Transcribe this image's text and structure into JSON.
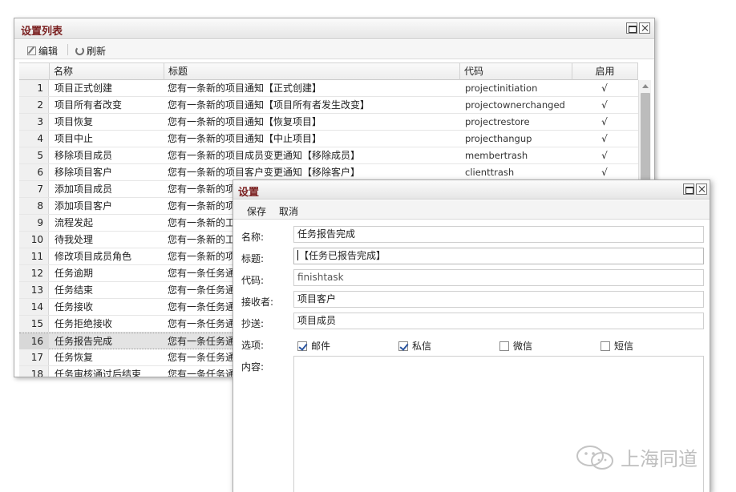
{
  "list_window": {
    "title": "设置列表",
    "toolbar": {
      "edit_label": "编辑",
      "refresh_label": "刷新"
    },
    "columns": {
      "name": "名称",
      "title": "标题",
      "code": "代码",
      "enabled": "启用"
    },
    "rows": [
      {
        "num": "1",
        "name": "项目正式创建",
        "title": "您有一条新的项目通知【正式创建】",
        "code": "projectinitiation",
        "enabled": "√"
      },
      {
        "num": "2",
        "name": "项目所有者改变",
        "title": "您有一条新的项目通知【项目所有者发生改变】",
        "code": "projectownerchanged",
        "enabled": "√"
      },
      {
        "num": "3",
        "name": "项目恢复",
        "title": "您有一条新的项目通知【恢复项目】",
        "code": "projectrestore",
        "enabled": "√"
      },
      {
        "num": "4",
        "name": "项目中止",
        "title": "您有一条新的项目通知【中止项目】",
        "code": "projecthangup",
        "enabled": "√"
      },
      {
        "num": "5",
        "name": "移除项目成员",
        "title": "您有一条新的项目成员变更通知【移除成员】",
        "code": "membertrash",
        "enabled": "√"
      },
      {
        "num": "6",
        "name": "移除项目客户",
        "title": "您有一条新的项目客户变更通知【移除客户】",
        "code": "clienttrash",
        "enabled": "√"
      },
      {
        "num": "7",
        "name": "添加项目成员",
        "title": "您有一条新的项",
        "code": "",
        "enabled": ""
      },
      {
        "num": "8",
        "name": "添加项目客户",
        "title": "您有一条新的项",
        "code": "",
        "enabled": ""
      },
      {
        "num": "9",
        "name": "流程发起",
        "title": "您有一条新的工",
        "code": "",
        "enabled": ""
      },
      {
        "num": "10",
        "name": "待我处理",
        "title": "您有一条新的工",
        "code": "",
        "enabled": ""
      },
      {
        "num": "11",
        "name": "修改项目成员角色",
        "title": "您有一条新的项",
        "code": "",
        "enabled": ""
      },
      {
        "num": "12",
        "name": "任务逾期",
        "title": "您有一条任务通",
        "code": "",
        "enabled": ""
      },
      {
        "num": "13",
        "name": "任务结束",
        "title": "您有一条任务通",
        "code": "",
        "enabled": ""
      },
      {
        "num": "14",
        "name": "任务接收",
        "title": "您有一条任务通",
        "code": "",
        "enabled": ""
      },
      {
        "num": "15",
        "name": "任务拒绝接收",
        "title": "您有一条任务通",
        "code": "",
        "enabled": ""
      },
      {
        "num": "16",
        "name": "任务报告完成",
        "title": "您有一条任务通",
        "code": "",
        "enabled": ""
      },
      {
        "num": "17",
        "name": "任务恢复",
        "title": "您有一条任务通",
        "code": "",
        "enabled": ""
      },
      {
        "num": "18",
        "name": "任务审核通过后结束",
        "title": "您有一条任务通",
        "code": "",
        "enabled": ""
      }
    ]
  },
  "dialog": {
    "title": "设置",
    "toolbar": {
      "save_label": "保存",
      "cancel_label": "取消"
    },
    "labels": {
      "name": "名称:",
      "title": "标题:",
      "code": "代码:",
      "receiver": "接收者:",
      "cc": "抄送:",
      "options": "选项:",
      "content": "内容:"
    },
    "values": {
      "name": "任务报告完成",
      "title": "【任务已报告完成】",
      "code": "finishtask",
      "receiver": "项目客户",
      "cc": "项目成员"
    },
    "options": [
      {
        "label": "邮件",
        "checked": true
      },
      {
        "label": "私信",
        "checked": true
      },
      {
        "label": "微信",
        "checked": false
      },
      {
        "label": "短信",
        "checked": false
      }
    ]
  },
  "watermark": {
    "text": "上海同道"
  }
}
